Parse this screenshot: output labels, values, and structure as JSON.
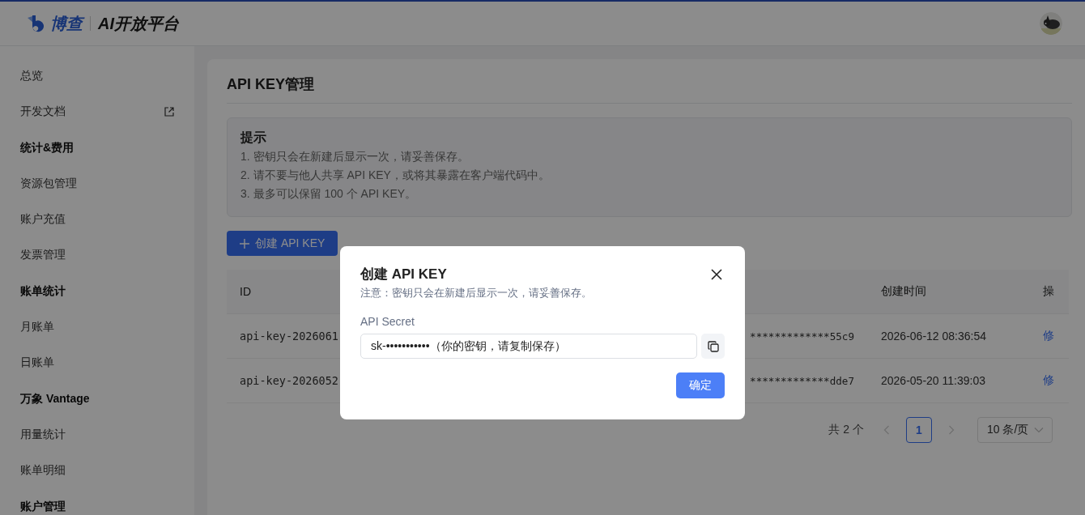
{
  "header": {
    "brand": "博查",
    "product": "AI开放平台"
  },
  "sidebar": {
    "items": [
      {
        "kind": "item",
        "label": "总览",
        "external": false
      },
      {
        "kind": "item",
        "label": "开发文档",
        "external": true
      },
      {
        "kind": "group",
        "label": "统计&费用"
      },
      {
        "kind": "item",
        "label": "资源包管理",
        "external": false
      },
      {
        "kind": "item",
        "label": "账户充值",
        "external": false
      },
      {
        "kind": "item",
        "label": "发票管理",
        "external": false
      },
      {
        "kind": "group",
        "label": "账单统计"
      },
      {
        "kind": "item",
        "label": "月账单",
        "external": false
      },
      {
        "kind": "item",
        "label": "日账单",
        "external": false
      },
      {
        "kind": "group",
        "label": "万象 Vantage"
      },
      {
        "kind": "item",
        "label": "用量统计",
        "external": false
      },
      {
        "kind": "item",
        "label": "账单明细",
        "external": false
      },
      {
        "kind": "group",
        "label": "账户管理"
      }
    ]
  },
  "page": {
    "title": "API KEY管理",
    "tip": {
      "title": "提示",
      "lines": [
        "1. 密钥只会在新建后显示一次，请妥善保存。",
        "2. 请不要与他人共享 API KEY，或将其暴露在客户端代码中。",
        "3. 最多可以保留 100 个 API KEY。"
      ]
    },
    "create_button": "创建 API KEY"
  },
  "table": {
    "columns": [
      {
        "label": "ID"
      },
      {
        "label": "创建时间"
      },
      {
        "label": "操"
      }
    ],
    "rows": [
      {
        "id": "api-key-2026061",
        "key": "*************55c9",
        "created": "2026-06-12 08:36:54",
        "action": "修"
      },
      {
        "id": "api-key-2026052",
        "key": "*************dde7",
        "created": "2026-05-20 11:39:03",
        "action": "修"
      }
    ]
  },
  "pagination": {
    "total": "共 2 个",
    "prev_disabled": true,
    "next_disabled": true,
    "pages": [
      {
        "label": "1",
        "selected": true
      }
    ],
    "page_size": "10 条/页"
  },
  "modal": {
    "title": "创建 API KEY",
    "note": "注意：密钥只会在新建后显示一次，请妥善保存。",
    "field_label": "API Secret",
    "value": "sk-•••••••••••（你的密钥，请复制保存）",
    "confirm": "确定"
  }
}
